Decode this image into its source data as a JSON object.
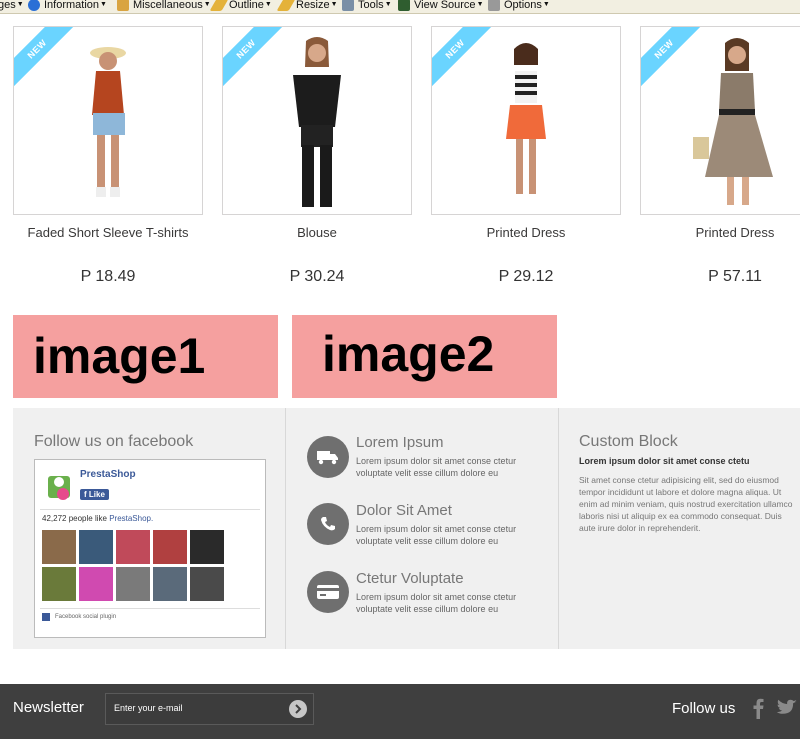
{
  "toolbar": {
    "items": [
      {
        "label": "ges",
        "icon": "pages-icon"
      },
      {
        "label": "Information",
        "icon": "info-icon"
      },
      {
        "label": "Miscellaneous",
        "icon": "misc-icon"
      },
      {
        "label": "Outline",
        "icon": "outline-pencil-icon"
      },
      {
        "label": "Resize",
        "icon": "resize-pencil-icon"
      },
      {
        "label": "Tools",
        "icon": "tools-icon"
      },
      {
        "label": "View Source",
        "icon": "view-source-icon"
      },
      {
        "label": "Options",
        "icon": "options-icon"
      }
    ]
  },
  "products": [
    {
      "name": "Faded Short Sleeve T-shirts",
      "price": "P 18.49",
      "badge": "NEW"
    },
    {
      "name": "Blouse",
      "price": "P 30.24",
      "badge": "NEW"
    },
    {
      "name": "Printed Dress",
      "price": "P 29.12",
      "badge": "NEW"
    },
    {
      "name": "Printed Dress",
      "price": "P 57.11",
      "badge": "NEW"
    }
  ],
  "banners": {
    "image1": "image1",
    "image2": "image2"
  },
  "facebook": {
    "title": "Follow us on facebook",
    "page_name": "PrestaShop",
    "like_label": "Like",
    "count_text": "42,272 people like",
    "count_link": "PrestaShop.",
    "plugin_label": "Facebook social plugin"
  },
  "features": [
    {
      "title": "Lorem Ipsum",
      "text": "Lorem ipsum dolor sit amet conse ctetur voluptate velit esse cillum dolore eu",
      "icon": "truck-icon"
    },
    {
      "title": "Dolor Sit Amet",
      "text": "Lorem ipsum dolor sit amet conse ctetur voluptate velit esse cillum dolore eu",
      "icon": "phone-icon"
    },
    {
      "title": "Ctetur Voluptate",
      "text": "Lorem ipsum dolor sit amet conse ctetur voluptate velit esse cillum dolore eu",
      "icon": "credit-card-icon"
    }
  ],
  "custom_block": {
    "title": "Custom Block",
    "bold": "Lorem ipsum dolor sit amet conse ctetu",
    "text": "Sit amet conse ctetur adipisicing elit, sed do eiusmod tempor incididunt ut labore et dolore magna aliqua. Ut enim ad minim veniam, quis nostrud exercitation ullamco laboris nisi ut aliquip ex ea commodo consequat. Duis aute irure dolor in reprehenderit."
  },
  "newsletter": {
    "label": "Newsletter",
    "placeholder": "Enter your e-mail",
    "follow_label": "Follow us"
  },
  "colors": {
    "banner": "#f5a09f",
    "ribbon": "#6ad4ff",
    "footer_bar": "#3f3f3f",
    "info_bg": "#f0f0f0"
  }
}
